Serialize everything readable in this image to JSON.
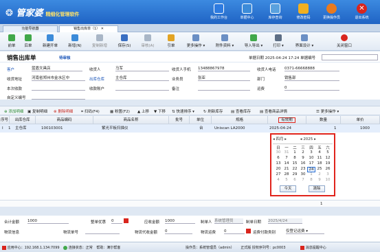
{
  "app": {
    "brand": "管家婆",
    "tagline": "精细化管理软件"
  },
  "header_buttons": [
    {
      "label": "我的工作台",
      "icon": "desktop-icon",
      "color": "#2e7be0"
    },
    {
      "label": "单据中心",
      "icon": "document-icon",
      "color": "#3c8bd9"
    },
    {
      "label": "库存查询",
      "icon": "warehouse-icon",
      "color": "#4a9ad6"
    },
    {
      "label": "修改密码",
      "icon": "lock-icon",
      "color": "#f1b021"
    },
    {
      "label": "更换操作员",
      "icon": "user-icon",
      "color": "#e97a1f"
    },
    {
      "label": "退出系统",
      "icon": "exit-icon",
      "color": "#d9251d"
    }
  ],
  "tabs": [
    "功能导航器",
    "销售出库单（1）"
  ],
  "toolbar": [
    "前单",
    "后单",
    "新建开单",
    "新增(N)",
    "复制新增",
    "保存(S)",
    "审核(A)",
    "引单",
    "更多操作",
    "附件资料",
    "导入导出",
    "打印",
    "界面设计",
    "关闭窗口"
  ],
  "title": "销售出库单",
  "audit_status": "待审核",
  "date_label": "单据日期",
  "date_value": "2025-04-24 17:24",
  "number_label": "单据编号",
  "form": {
    "customer_label": "客户",
    "customer": "蓝盾文具店",
    "receiver_label": "收货人",
    "receiver": "马军",
    "phone_label": "收货人手机",
    "phone": "13488867978",
    "tel_label": "收货人电话",
    "tel": "0371-66668888",
    "address_label": "收货地址",
    "address": "河南省郑州市金水区中",
    "warehouse_label": "出库仓库",
    "warehouse": "主仓库",
    "salesman_label": "业务员",
    "salesman": "张亚",
    "dept_label": "部门",
    "dept": "销售部",
    "receive_label": "本次收款",
    "account_label": "收款账户",
    "remark_label": "备注",
    "freight_label": "运费",
    "freight": "0",
    "custom_label": "自定义编号"
  },
  "subtoolbar": [
    "添加明细",
    "复制明细",
    "删除明细",
    "扫码(F4)",
    "粉置(F2)",
    "上移",
    "下移",
    "快速排序",
    "刷新库存",
    "查看库存",
    "查看商品详情",
    "更多操作"
  ],
  "grid": {
    "headers": [
      "序号",
      "出库仓库",
      "商品编码",
      "商品名称",
      "批号",
      "单位",
      "规格",
      "有效期",
      "数量",
      "单价"
    ],
    "row": {
      "idx": "1",
      "sel": "I",
      "warehouse": "主仓库",
      "code": "100103001",
      "name": "紫光平板扫描仪",
      "batch": "",
      "unit": "台",
      "spec": "Uniscan LA2000",
      "expiry": "2025-04-24",
      "qty": "1",
      "price": "1000"
    },
    "sum_qty": "1"
  },
  "calendar": {
    "month": "四月",
    "year": "2025",
    "weekdays": [
      "日",
      "一",
      "二",
      "三",
      "四",
      "五",
      "六"
    ],
    "days": [
      [
        "30",
        "31",
        "1",
        "2",
        "3",
        "4",
        "5"
      ],
      [
        "6",
        "7",
        "8",
        "9",
        "10",
        "11",
        "12"
      ],
      [
        "13",
        "14",
        "15",
        "16",
        "17",
        "18",
        "19"
      ],
      [
        "20",
        "21",
        "22",
        "23",
        "24",
        "25",
        "26"
      ],
      [
        "27",
        "28",
        "29",
        "30",
        "1",
        "2",
        "3"
      ],
      [
        "4",
        "5",
        "6",
        "7",
        "8",
        "9",
        "10"
      ]
    ],
    "selected": "24",
    "today_label": "今天",
    "clear_label": "清除"
  },
  "footer": {
    "total_label": "合计金额",
    "total": "1000",
    "discount_label": "整单优惠",
    "discount": "0",
    "receivable_label": "应收金额",
    "receivable": "1000",
    "maker_label": "制单人",
    "maker": "系统管理员",
    "make_date_label": "制单日期",
    "make_date": "2025/4/24",
    "logistics_label": "物流信息",
    "waybill_label": "物流单号",
    "cod_label": "物流代收金额",
    "cod": "0",
    "fee_label": "物流运费",
    "fee": "0",
    "freight_pay_label": "运费付款类别",
    "freight_pay": "仅登记运费"
  },
  "statusbar": {
    "app_center": "应用中心：",
    "ip": "192.168.1.134:7099",
    "connection": "连接状态：正常",
    "help": "帮助：满尔帮客",
    "operator": "操作员：系统管理员（admin）",
    "version": "正式版 授权序列号：pc0003",
    "chat": "消息提醒中心"
  }
}
